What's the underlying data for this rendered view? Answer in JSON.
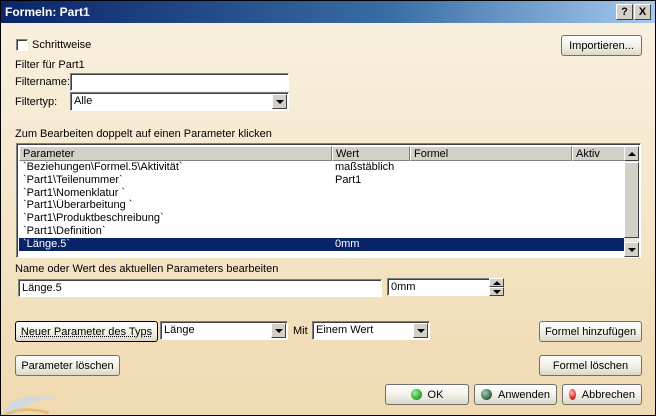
{
  "window": {
    "title": "Formeln: Part1",
    "help_label": "?",
    "close_label": "X"
  },
  "top": {
    "schrittweise_label": "Schrittweise",
    "schrittweise_checked": false,
    "import_button": "Importieren..."
  },
  "filter": {
    "group_label": "Filter für Part1",
    "name_label": "Filtername:",
    "name_value": "",
    "type_label": "Filtertyp:",
    "type_value": "Alle"
  },
  "params": {
    "instruction": "Zum Bearbeiten doppelt auf einen Parameter klicken",
    "columns": [
      "Parameter",
      "Wert",
      "Formel",
      "Aktiv"
    ],
    "rows": [
      {
        "parameter": "`Beziehungen\\Formel.5\\Aktivität`",
        "wert": "maßstäblich",
        "formel": "",
        "aktiv": ""
      },
      {
        "parameter": "`Part1\\Teilenummer`",
        "wert": "Part1",
        "formel": "",
        "aktiv": ""
      },
      {
        "parameter": "`Part1\\Nomenklatur `",
        "wert": "",
        "formel": "",
        "aktiv": ""
      },
      {
        "parameter": "`Part1\\Überarbeitung `",
        "wert": "",
        "formel": "",
        "aktiv": ""
      },
      {
        "parameter": "`Part1\\Produktbeschreibung`",
        "wert": "",
        "formel": "",
        "aktiv": ""
      },
      {
        "parameter": "`Part1\\Definition`",
        "wert": "",
        "formel": "",
        "aktiv": ""
      },
      {
        "parameter": "`Länge.5`",
        "wert": "0mm",
        "formel": "",
        "aktiv": ""
      }
    ],
    "selected_index": 6
  },
  "edit": {
    "label": "Name oder Wert des aktuellen Parameters bearbeiten",
    "name_value": "Länge.5",
    "value": "0mm"
  },
  "new_param": {
    "button": "Neuer Parameter des Typs",
    "type_value": "Länge",
    "mit_label": "Mit",
    "mode_value": "Einem Wert",
    "add_formula_button": "Formel hinzufügen"
  },
  "actions": {
    "delete_param_button": "Parameter löschen",
    "delete_formula_button": "Formel löschen",
    "ok_button": "OK",
    "apply_button": "Anwenden",
    "cancel_button": "Abbrechen"
  },
  "colors": {
    "ok_icon": "#22a022",
    "apply_icon": "#2f5f3f",
    "cancel_icon": "#d02020",
    "selection": "#0a246a"
  }
}
